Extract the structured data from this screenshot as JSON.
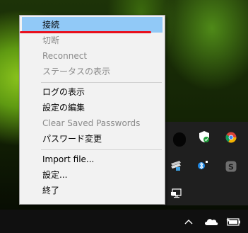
{
  "context_menu": {
    "items": [
      {
        "label": "接続",
        "enabled": true,
        "highlighted": true
      },
      {
        "label": "切断",
        "enabled": false
      },
      {
        "label": "Reconnect",
        "enabled": false
      },
      {
        "label": "ステータスの表示",
        "enabled": false
      },
      {
        "label": "ログの表示",
        "enabled": true
      },
      {
        "label": "設定の編集",
        "enabled": true
      },
      {
        "label": "Clear Saved Passwords",
        "enabled": false
      },
      {
        "label": "パスワード変更",
        "enabled": true
      },
      {
        "label": "Import file...",
        "enabled": true
      },
      {
        "label": "設定...",
        "enabled": true
      },
      {
        "label": "終了",
        "enabled": true
      }
    ],
    "highlight_color": "#91c9f7",
    "annotation_color": "#e8101d"
  },
  "tray_overflow": {
    "icons": [
      "vpn-lock-icon",
      "security-shield-icon",
      "chrome-icon",
      "network-app-icon",
      "bluetooth-icon",
      "skype-icon",
      "remote-desktop-icon"
    ]
  },
  "taskbar": {
    "icons": [
      "chevron-up-icon",
      "onedrive-cloud-icon",
      "battery-icon"
    ]
  }
}
